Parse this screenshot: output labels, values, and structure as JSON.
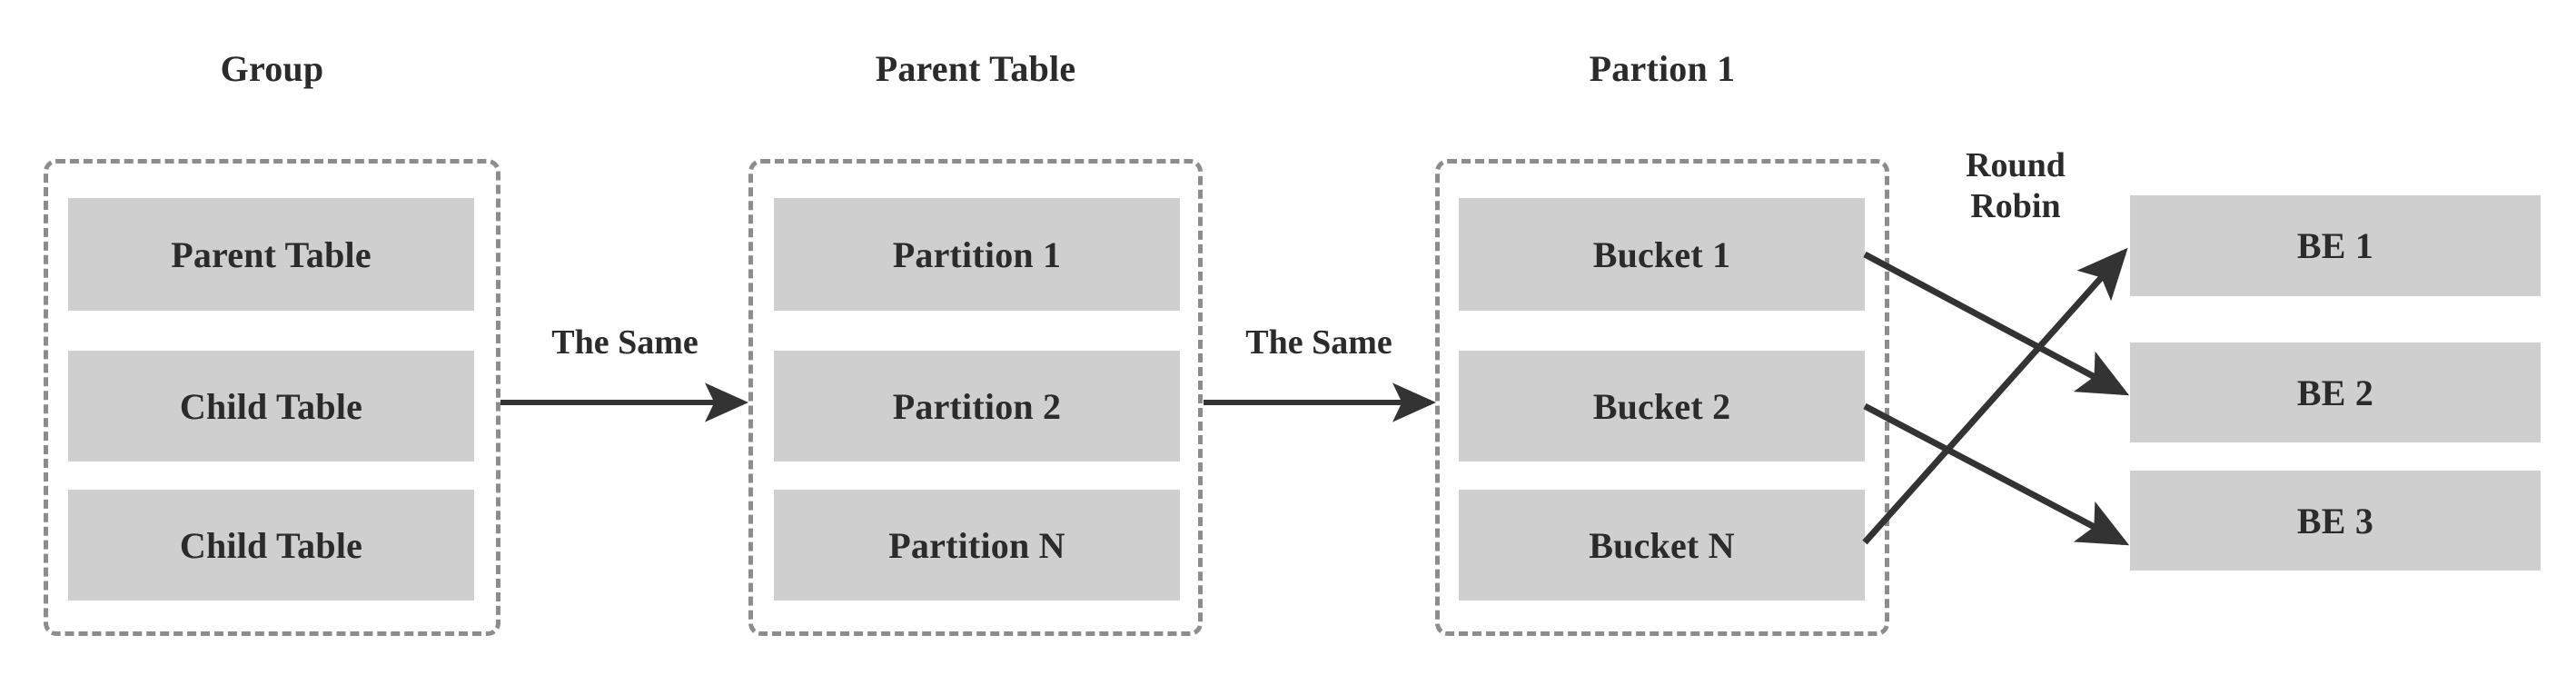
{
  "diagram": {
    "title_group": "Group",
    "title_parent_table": "Parent Table",
    "title_partition": "Partion 1",
    "colors": {
      "box_fill": "#cfcfcf",
      "dashed_border": "#8c8c8c",
      "text": "#2b2b2b",
      "arrow": "#333333",
      "background": "#ffffff"
    },
    "groups": [
      {
        "name": "group-column",
        "title": "Group",
        "items": [
          {
            "label": "Parent Table"
          },
          {
            "label": "Child Table"
          },
          {
            "label": "Child Table"
          }
        ]
      },
      {
        "name": "parent-table-column",
        "title": "Parent Table",
        "items": [
          {
            "label": "Partition 1"
          },
          {
            "label": "Partition 2"
          },
          {
            "label": "Partition N"
          }
        ]
      },
      {
        "name": "partition-column",
        "title": "Partion 1",
        "items": [
          {
            "label": "Bucket 1"
          },
          {
            "label": "Bucket 2"
          },
          {
            "label": "Bucket N"
          }
        ]
      }
    ],
    "backends": [
      {
        "label": "BE 1"
      },
      {
        "label": "BE 2"
      },
      {
        "label": "BE 3"
      }
    ],
    "edge_labels": {
      "same_1": "The Same",
      "same_2": "The Same",
      "round_robin": "Round Robin"
    },
    "connections": [
      {
        "from": "Bucket 1",
        "to": "BE 2",
        "style": "round-robin-arrow"
      },
      {
        "from": "Bucket 2",
        "to": "BE 3",
        "style": "round-robin-arrow"
      },
      {
        "from": "Bucket N",
        "to": "BE 1",
        "style": "round-robin-arrow"
      },
      {
        "from": "Group",
        "to": "Parent Table",
        "style": "straight-arrow"
      },
      {
        "from": "Parent Table",
        "to": "Partion 1",
        "style": "straight-arrow"
      }
    ]
  }
}
